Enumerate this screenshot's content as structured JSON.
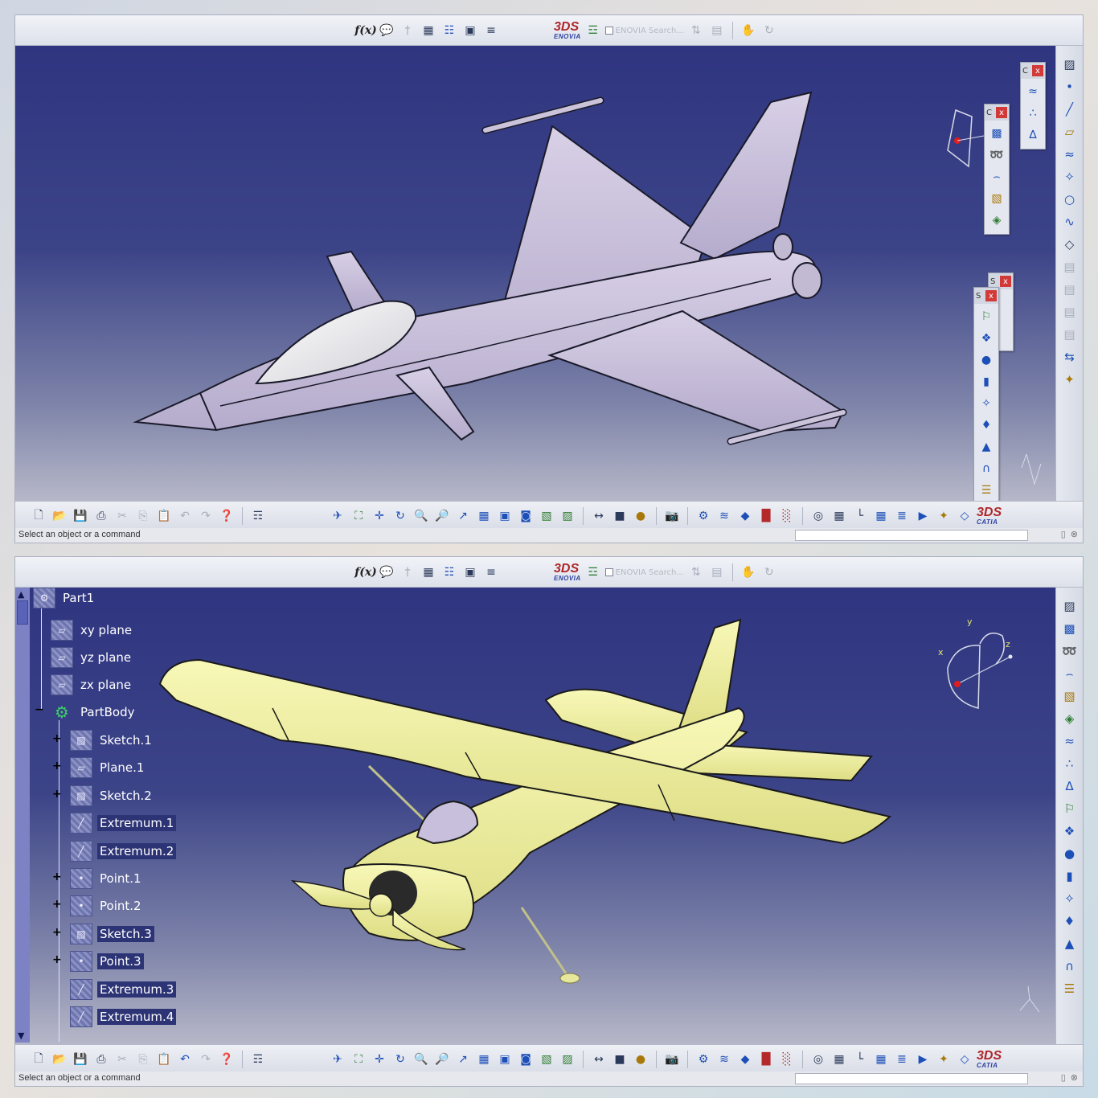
{
  "top_window": {
    "toolbar": {
      "fx_label": "f(x)",
      "enovia_brand": "ENOVIA",
      "search_placeholder": "ENOVIA Search..."
    },
    "floating_toolbars": [
      {
        "title": "C",
        "close": "x"
      },
      {
        "title": "C",
        "close": "x"
      },
      {
        "title": "S",
        "close": "x"
      },
      {
        "title": "S",
        "close": "x"
      }
    ],
    "status_text": "Select an object or a command",
    "catia_brand": "CATIA"
  },
  "bottom_window": {
    "toolbar": {
      "fx_label": "f(x)",
      "enovia_brand": "ENOVIA",
      "search_placeholder": "ENOVIA Search..."
    },
    "compass": {
      "x": "x",
      "y": "y",
      "z": "z"
    },
    "tree": {
      "root": "Part1",
      "items": [
        {
          "label": "xy plane",
          "icon": "plane-icon"
        },
        {
          "label": "yz plane",
          "icon": "plane-icon"
        },
        {
          "label": "zx plane",
          "icon": "plane-icon"
        },
        {
          "label": "PartBody",
          "icon": "gear-icon"
        },
        {
          "label": "Sketch.1",
          "icon": "sketch-icon"
        },
        {
          "label": "Plane.1",
          "icon": "plane-icon"
        },
        {
          "label": "Sketch.2",
          "icon": "sketch-icon"
        },
        {
          "label": "Extremum.1",
          "icon": "extremum-icon"
        },
        {
          "label": "Extremum.2",
          "icon": "extremum-icon"
        },
        {
          "label": "Point.1",
          "icon": "point-icon"
        },
        {
          "label": "Point.2",
          "icon": "point-icon"
        },
        {
          "label": "Sketch.3",
          "icon": "sketch-icon"
        },
        {
          "label": "Point.3",
          "icon": "point-icon"
        },
        {
          "label": "Extremum.3",
          "icon": "extremum-icon"
        },
        {
          "label": "Extremum.4",
          "icon": "extremum-icon"
        }
      ]
    },
    "status_text": "Select an object or a command",
    "catia_brand": "CATIA"
  },
  "colors": {
    "jet_body": "#c9c0db",
    "plane_body": "#f3f3a2",
    "viewport_top": "#2f3580",
    "viewport_bottom": "#b6b7c8"
  }
}
